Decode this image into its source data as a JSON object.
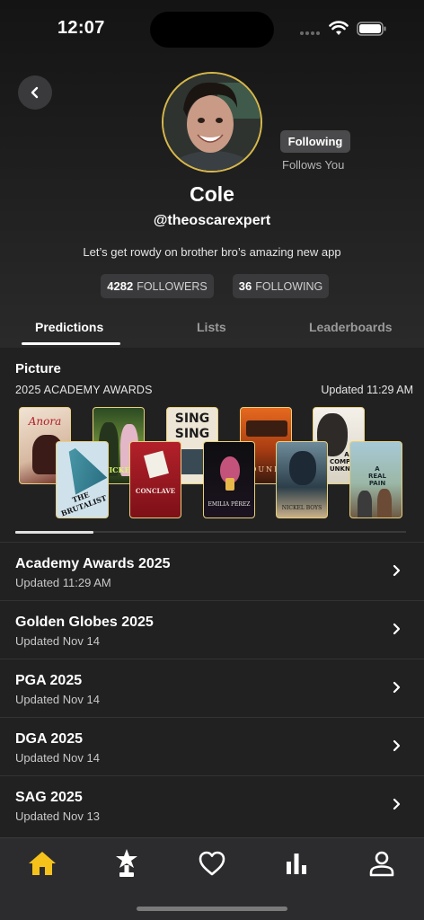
{
  "status_bar": {
    "time": "12:07"
  },
  "profile": {
    "following_label": "Following",
    "follows_you": "Follows You",
    "name": "Cole",
    "handle": "@theoscarexpert",
    "bio": "Let’s get rowdy on brother bro’s amazing new app",
    "followers_count": "4282",
    "followers_label": "FOLLOWERS",
    "following_count": "36",
    "following_stat_label": "FOLLOWING"
  },
  "tabs": [
    {
      "label": "Predictions",
      "active": true
    },
    {
      "label": "Lists",
      "active": false
    },
    {
      "label": "Leaderboards",
      "active": false
    }
  ],
  "section": {
    "title": "Picture",
    "subtitle": "2025 ACADEMY AWARDS",
    "updated": "Updated 11:29 AM"
  },
  "posters": [
    {
      "text": "Anora"
    },
    {
      "text": "THE BRUTALIST"
    },
    {
      "text": "WICKED"
    },
    {
      "text": "CONCLAVE"
    },
    {
      "text": "SING SING"
    },
    {
      "text": "EMILIA PÉREZ"
    },
    {
      "text": "DUNE"
    },
    {
      "text": "NICKEL BOYS"
    },
    {
      "text": "A COMPLETE UNKNOWN"
    },
    {
      "text": "A REAL PAIN"
    }
  ],
  "list": [
    {
      "title": "Academy Awards 2025",
      "updated": "Updated 11:29 AM"
    },
    {
      "title": "Golden Globes 2025",
      "updated": "Updated Nov 14"
    },
    {
      "title": "PGA 2025",
      "updated": "Updated Nov 14"
    },
    {
      "title": "DGA 2025",
      "updated": "Updated Nov 14"
    },
    {
      "title": "SAG 2025",
      "updated": "Updated Nov 13"
    }
  ],
  "nav": [
    {
      "icon": "home-icon",
      "active": true
    },
    {
      "icon": "award-icon",
      "active": false
    },
    {
      "icon": "heart-icon",
      "active": false
    },
    {
      "icon": "leaderboard-icon",
      "active": false
    },
    {
      "icon": "profile-icon",
      "active": false
    }
  ],
  "colors": {
    "accent": "#f5c21b",
    "avatar_ring": "#d8b84a",
    "poster_border": "#e8cf7a"
  }
}
